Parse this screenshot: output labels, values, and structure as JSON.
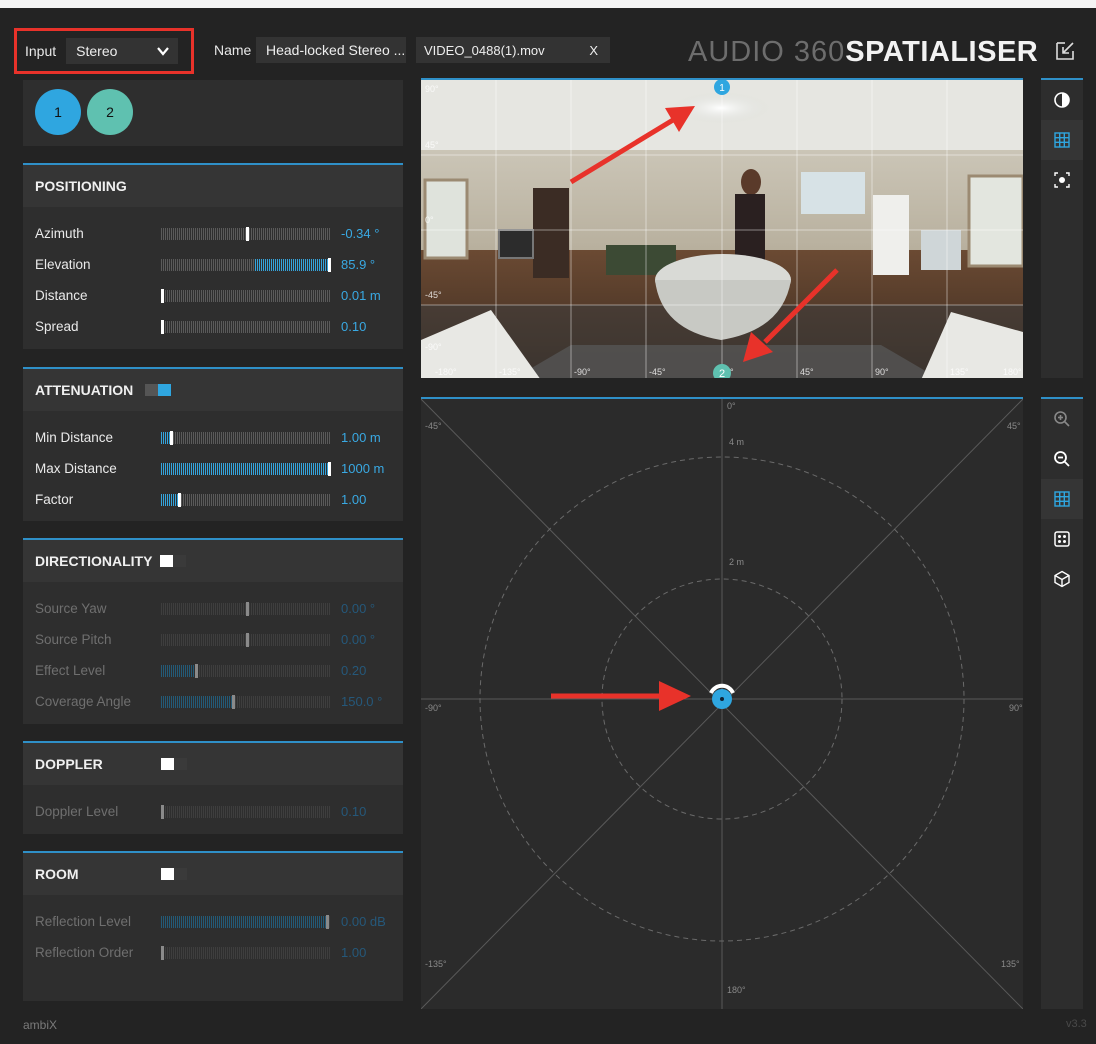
{
  "header": {
    "input_label": "Input",
    "input_value": "Stereo",
    "name_label": "Name",
    "name_value": "Head-locked Stereo ...",
    "file_name": "VIDEO_0488(1).mov",
    "file_close": "X",
    "logo_thin": "AUDIO 360",
    "logo_bold": "SPATIALISER"
  },
  "sources": [
    "1",
    "2"
  ],
  "positioning": {
    "title": "POSITIONING",
    "rows": [
      {
        "label": "Azimuth",
        "value": "-0.34 °",
        "level": 0.5
      },
      {
        "label": "Elevation",
        "value": "85.9 °",
        "level": 0.98
      },
      {
        "label": "Distance",
        "value": "0.01 m",
        "level": 0.0
      },
      {
        "label": "Spread",
        "value": "0.10",
        "level": 0.0
      }
    ]
  },
  "attenuation": {
    "title": "ATTENUATION",
    "enabled": true,
    "rows": [
      {
        "label": "Min Distance",
        "value": "1.00 m",
        "level": 0.05
      },
      {
        "label": "Max Distance",
        "value": "1000 m",
        "level": 1.0
      },
      {
        "label": "Factor",
        "value": "1.00",
        "level": 0.1
      }
    ]
  },
  "directionality": {
    "title": "DIRECTIONALITY",
    "enabled": false,
    "rows": [
      {
        "label": "Source Yaw",
        "value": "0.00 °",
        "level": 0.5
      },
      {
        "label": "Source Pitch",
        "value": "0.00 °",
        "level": 0.5
      },
      {
        "label": "Effect Level",
        "value": "0.20",
        "level": 0.2
      },
      {
        "label": "Coverage Angle",
        "value": "150.0 °",
        "level": 0.42
      }
    ]
  },
  "doppler": {
    "title": "DOPPLER",
    "enabled": false,
    "rows": [
      {
        "label": "Doppler Level",
        "value": "0.10",
        "level": 0.0
      }
    ]
  },
  "room": {
    "title": "ROOM",
    "enabled": false,
    "rows": [
      {
        "label": "Reflection Level",
        "value": "0.00 dB",
        "level": 0.97
      },
      {
        "label": "Reflection Order",
        "value": "1.00",
        "level": 0.0
      }
    ]
  },
  "video": {
    "grid_labels": [
      "90°",
      "45°",
      "0°",
      "-45°",
      "-90°",
      "-180°",
      "-135°",
      "-90°",
      "-45°",
      "0°",
      "45°",
      "90°",
      "135°",
      "180°"
    ]
  },
  "polar": {
    "angles": {
      "top": "0°",
      "top_left": "-45°",
      "top_right": "45°",
      "left": "-90°",
      "right": "90°",
      "bottom_left": "-135°",
      "bottom_right": "135°",
      "bottom": "180°"
    },
    "rings": [
      "4 m",
      "2 m"
    ]
  },
  "footer": {
    "left": "ambiX",
    "right": "v3.3"
  },
  "colors": {
    "accent": "#2fa6e0",
    "source1": "#2fa6e0",
    "source2": "#5fc1b0",
    "annotation": "#e8322a"
  }
}
